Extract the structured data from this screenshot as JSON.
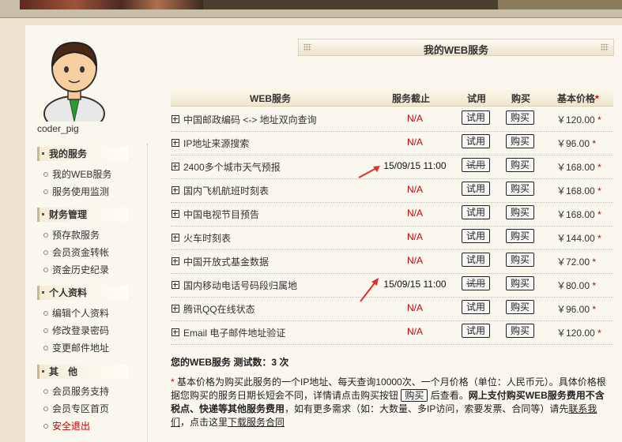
{
  "user": {
    "name": "coder_pig"
  },
  "sidebar": {
    "sections": [
      {
        "title": "我的服务",
        "items": [
          "我的WEB服务",
          "服务使用监测"
        ]
      },
      {
        "title": "财务管理",
        "items": [
          "预存款服务",
          "会员资金转帐",
          "资金历史纪录"
        ]
      },
      {
        "title": "个人资料",
        "items": [
          "编辑个人资料",
          "修改登录密码",
          "变更邮件地址"
        ]
      },
      {
        "title": "其　他",
        "items": [
          "会员服务支持",
          "会员专区首页",
          "安全退出"
        ]
      }
    ]
  },
  "page_title": "我的WEB服务",
  "table": {
    "headers": {
      "service": "WEB服务",
      "expiry": "服务截止",
      "trial": "试用",
      "buy": "购买",
      "price": "基本价格",
      "price_star": "*"
    },
    "rows": [
      {
        "name": "中国邮政编码 <-> 地址双向查询",
        "expiry": "N/A",
        "trial": "试用",
        "buy": "购买",
        "price": "￥120.00",
        "star": "*",
        "trial_used": false
      },
      {
        "name": "IP地址来源搜索",
        "expiry": "N/A",
        "trial": "试用",
        "buy": "购买",
        "price": "￥96.00",
        "star": "*",
        "trial_used": false
      },
      {
        "name": "2400多个城市天气预报",
        "expiry": "15/09/15 11:00",
        "trial": "试用",
        "buy": "购买",
        "price": "￥168.00",
        "star": "*",
        "trial_used": true
      },
      {
        "name": "国内飞机航班时刻表",
        "expiry": "N/A",
        "trial": "试用",
        "buy": "购买",
        "price": "￥168.00",
        "star": "*",
        "trial_used": false
      },
      {
        "name": "中国电视节目预告",
        "expiry": "N/A",
        "trial": "试用",
        "buy": "购买",
        "price": "￥168.00",
        "star": "*",
        "trial_used": false
      },
      {
        "name": "火车时刻表",
        "expiry": "N/A",
        "trial": "试用",
        "buy": "购买",
        "price": "￥144.00",
        "star": "*",
        "trial_used": false
      },
      {
        "name": "中国开放式基金数据",
        "expiry": "N/A",
        "trial": "试用",
        "buy": "购买",
        "price": "￥72.00",
        "star": "*",
        "trial_used": false
      },
      {
        "name": "国内移动电话号码段归属地",
        "expiry": "15/09/15 11:00",
        "trial": "试用",
        "buy": "购买",
        "price": "￥80.00",
        "star": "*",
        "trial_used": true
      },
      {
        "name": "腾讯QQ在线状态",
        "expiry": "N/A",
        "trial": "试用",
        "buy": "购买",
        "price": "￥96.00",
        "star": "*",
        "trial_used": false
      },
      {
        "name": "Email 电子邮件地址验证",
        "expiry": "N/A",
        "trial": "试用",
        "buy": "购买",
        "price": "￥120.00",
        "star": "*",
        "trial_used": false
      }
    ]
  },
  "summary": "您的WEB服务 测试数：3 次",
  "note": {
    "star": "*",
    "part1": " 基本价格为购买此服务的一个IP地址、每天查询10000次、一个月价格（单位：人民币元）。具体价格根据您购买的服务日期长短会不同，详情请点击购买按钮",
    "buy_label": "购买",
    "part2": "后查看。",
    "bold1": "网上支付购买WEB服务费用不含税点、快递等其他服务费用",
    "part3": "，如有更多需求（如：大数量、多IP访问，索要发票、合同等）请先",
    "link1": "联系我们",
    "part4": "，点击这里",
    "link2": "下载服务合同"
  },
  "colors": {
    "expiry_na": "#cc0000",
    "accent": "#c9b98a",
    "panel_bg": "#faf7ef",
    "page_bg": "#ede4cf"
  }
}
